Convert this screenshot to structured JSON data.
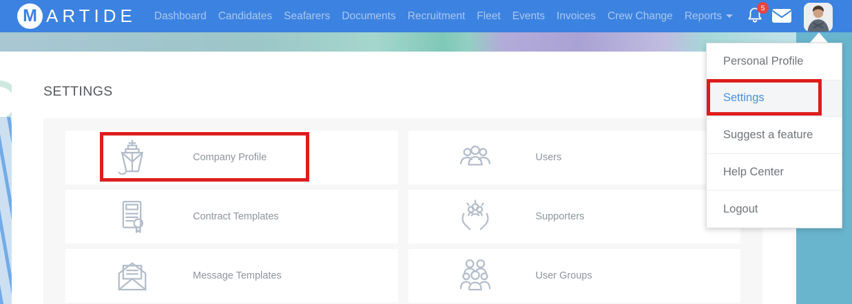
{
  "brand": {
    "logo_letter": "M",
    "wordmark": "ARTIDE",
    "full_name": "MARTIDE"
  },
  "nav": {
    "items": [
      {
        "label": "Dashboard"
      },
      {
        "label": "Candidates"
      },
      {
        "label": "Seafarers"
      },
      {
        "label": "Documents"
      },
      {
        "label": "Recruitment"
      },
      {
        "label": "Fleet"
      },
      {
        "label": "Events"
      },
      {
        "label": "Invoices"
      },
      {
        "label": "Crew Change"
      },
      {
        "label": "Reports",
        "has_dropdown": true
      }
    ]
  },
  "header": {
    "notification_count": "5",
    "icons": [
      "bell-icon",
      "mail-icon",
      "user-avatar"
    ]
  },
  "page": {
    "title": "SETTINGS"
  },
  "settings_cards": [
    {
      "label": "Company Profile",
      "icon": "ship-icon",
      "highlighted": true
    },
    {
      "label": "Users",
      "icon": "users-icon",
      "highlighted": false
    },
    {
      "label": "Contract Templates",
      "icon": "contract-document-icon",
      "highlighted": false
    },
    {
      "label": "Supporters",
      "icon": "hands-holding-people-icon",
      "highlighted": false
    },
    {
      "label": "Message Templates",
      "icon": "open-envelope-icon",
      "highlighted": false
    },
    {
      "label": "User Groups",
      "icon": "people-group-icon",
      "highlighted": false
    }
  ],
  "profile_menu": {
    "items": [
      {
        "label": "Personal Profile",
        "active": false
      },
      {
        "label": "Settings",
        "active": true
      },
      {
        "label": "Suggest a feature",
        "active": false
      },
      {
        "label": "Help Center",
        "active": false
      },
      {
        "label": "Logout",
        "active": false
      }
    ]
  },
  "annotations": {
    "color": "#dd1d1d",
    "highlighted_card": "Company Profile",
    "highlighted_menu_item": "Settings"
  },
  "colors": {
    "header_blue": "#3c82e0",
    "accent_teal": "#69b5ce",
    "active_link_blue": "#4a90d9",
    "badge_red": "#e8463f",
    "annotation_red": "#dd1d1d"
  }
}
